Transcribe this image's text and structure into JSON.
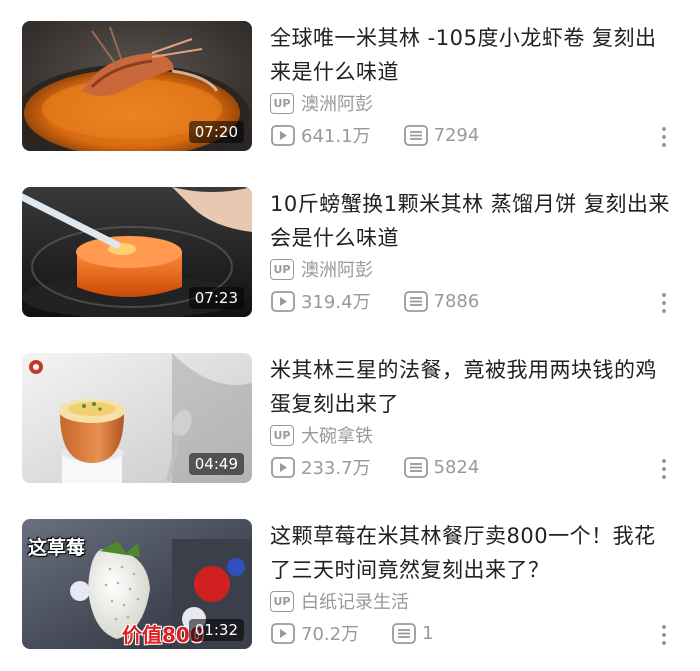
{
  "videos": [
    {
      "title": "全球唯一米其林  -105度小龙虾卷  复刻出来是什么味道",
      "up_badge": "UP",
      "uploader": "澳洲阿彭",
      "views": "641.1万",
      "comments": "7294",
      "duration": "07:20",
      "thumb_icon": "crayfish-thumbnail"
    },
    {
      "title": "10斤螃蟹换1颗米其林  蒸馏月饼  复刻出来会是什么味道",
      "up_badge": "UP",
      "uploader": "澳洲阿彭",
      "views": "319.4万",
      "comments": "7886",
      "duration": "07:23",
      "thumb_icon": "orange-jelly-thumbnail"
    },
    {
      "title": "米其林三星的法餐，竟被我用两块钱的鸡蛋复刻出来了",
      "up_badge": "UP",
      "uploader": "大碗拿铁",
      "views": "233.7万",
      "comments": "5824",
      "duration": "04:49",
      "thumb_icon": "egg-cup-thumbnail"
    },
    {
      "title": "这颗草莓在米其林餐厅卖800一个！我花了三天时间竟然复刻出来了？",
      "up_badge": "UP",
      "uploader": "白纸记录生活",
      "views": "70.2万",
      "comments": "1",
      "duration": "01:32",
      "thumb_icon": "white-strawberry-thumbnail",
      "thumb_text_top": "这草莓",
      "thumb_text_bottom": "价值800"
    }
  ],
  "colors": {
    "text_primary": "#212121",
    "text_secondary": "#999999",
    "background": "#ffffff"
  },
  "icons": {
    "views": "play-count-icon",
    "comments": "danmaku-icon",
    "more": "more-vertical-icon"
  }
}
